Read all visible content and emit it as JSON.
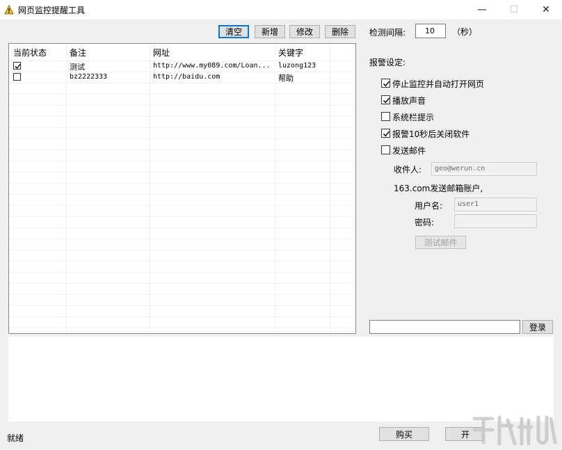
{
  "window": {
    "title": "网页监控提醒工具",
    "minimize_glyph": "—",
    "maximize_glyph": "☐",
    "close_glyph": "✕"
  },
  "toolbar": {
    "clear_label": "清空",
    "add_label": "新增",
    "edit_label": "修改",
    "delete_label": "删除"
  },
  "list": {
    "columns": [
      "当前状态",
      "备注",
      "网址",
      "关键字"
    ],
    "rows": [
      {
        "checked": true,
        "note": "测试",
        "url": "http://www.my089.com/Loan...",
        "keyword": "luzong123"
      },
      {
        "checked": false,
        "note": "bz2222333",
        "url": "http://baidu.com",
        "keyword": "帮助"
      }
    ]
  },
  "settings": {
    "interval_label": "检测间隔:",
    "interval_value": "10",
    "interval_unit": "（秒）",
    "alarm_title": "报警设定:",
    "options": [
      {
        "label": "停止监控并自动打开网页",
        "checked": true
      },
      {
        "label": "播放声音",
        "checked": true
      },
      {
        "label": "系统栏提示",
        "checked": false
      },
      {
        "label": "报警10秒后关闭软件",
        "checked": true
      },
      {
        "label": "发送邮件",
        "checked": false
      }
    ],
    "recipient_label": "收件人:",
    "recipient_value": "geo@werun.cn",
    "account_label": "163.com发送邮箱账户,",
    "username_label": "用户名:",
    "username_value": "user1",
    "password_label": "密码:",
    "password_value": "",
    "test_mail_label": "测试邮件"
  },
  "login": {
    "input_value": "",
    "button_label": "登录"
  },
  "bottom": {
    "status_text": "就绪",
    "buy_label": "购买",
    "start_label": "开"
  },
  "colors": {
    "accent": "#0078d7",
    "window_bg": "#f0f0f0"
  }
}
